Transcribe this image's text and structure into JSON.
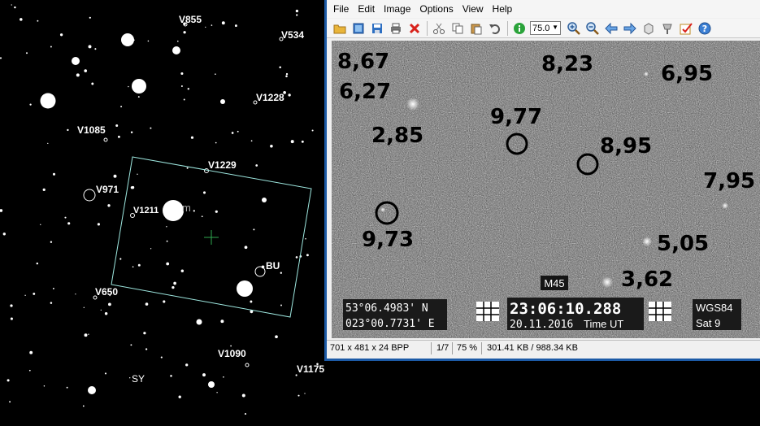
{
  "starmap": {
    "labels": [
      "V855",
      "V534",
      "V1228",
      "V1085",
      "V1229",
      "V971",
      "V1211",
      "m",
      "BU",
      "V650",
      "V1090",
      "V1175",
      "SY"
    ]
  },
  "viewer": {
    "menu": [
      "File",
      "Edit",
      "Image",
      "Options",
      "View",
      "Help"
    ],
    "toolbar": {
      "icons": [
        "open-folder-icon",
        "thumbnails-icon",
        "save-icon",
        "print-icon",
        "delete-icon",
        "cut-icon",
        "copy-icon",
        "paste-icon",
        "undo-icon",
        "info-icon",
        "zoom-in-icon",
        "zoom-out-icon",
        "previous-icon",
        "next-icon",
        "rotate-left-icon",
        "rotate-right-icon",
        "edit-icon",
        "help-icon"
      ],
      "zoom_value": "75.0"
    },
    "image": {
      "annotations": [
        "8,67",
        "8,23",
        "6,95",
        "6,27",
        "9,77",
        "2,85",
        "8,95",
        "7,95",
        "9,73",
        "5,05",
        "3,62"
      ],
      "overlay": {
        "lat": "53°06.4983' N",
        "lon": "023°00.7731' E",
        "time": "23:06:10.288",
        "date": "20.11.2016",
        "time_label": "Time UT",
        "target": "M45",
        "datum": "WGS84",
        "sat": "Sat 9"
      }
    },
    "status": {
      "dimensions": "701 x 481 x 24 BPP",
      "index": "1/7",
      "zoom": "75 %",
      "size": "301.41 KB / 988.34 KB"
    }
  }
}
